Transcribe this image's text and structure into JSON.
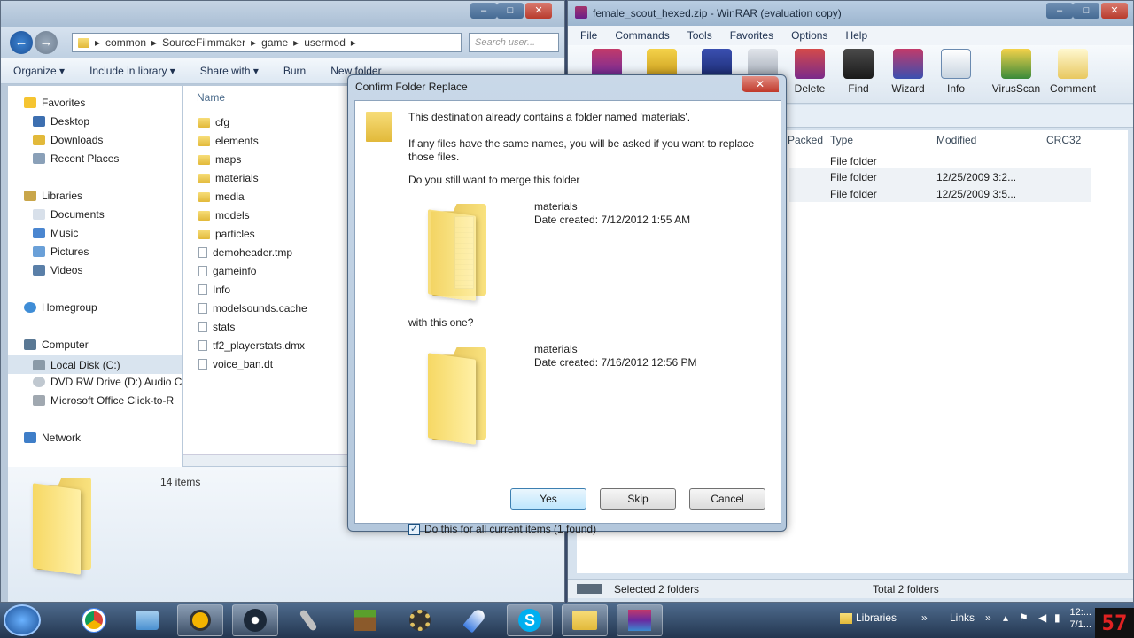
{
  "explorer": {
    "breadcrumb": [
      "common",
      "SourceFilmmaker",
      "game",
      "usermod"
    ],
    "search_placeholder": "Search user...",
    "commands": [
      "Organize ▾",
      "Include in library ▾",
      "Share with ▾",
      "Burn",
      "New folder"
    ],
    "nav": {
      "favorites": "Favorites",
      "desktop": "Desktop",
      "downloads": "Downloads",
      "recent": "Recent Places",
      "libraries": "Libraries",
      "documents": "Documents",
      "music": "Music",
      "pictures": "Pictures",
      "videos": "Videos",
      "homegroup": "Homegroup",
      "computer": "Computer",
      "local_disk": "Local Disk (C:)",
      "dvd": "DVD RW Drive (D:) Audio C",
      "office": "Microsoft Office Click-to-R",
      "network": "Network"
    },
    "column_name": "Name",
    "files": [
      {
        "name": "cfg",
        "kind": "folder"
      },
      {
        "name": "elements",
        "kind": "folder"
      },
      {
        "name": "maps",
        "kind": "folder"
      },
      {
        "name": "materials",
        "kind": "folder"
      },
      {
        "name": "media",
        "kind": "folder"
      },
      {
        "name": "models",
        "kind": "folder"
      },
      {
        "name": "particles",
        "kind": "folder"
      },
      {
        "name": "demoheader.tmp",
        "kind": "file"
      },
      {
        "name": "gameinfo",
        "kind": "file"
      },
      {
        "name": "Info",
        "kind": "file"
      },
      {
        "name": "modelsounds.cache",
        "kind": "file"
      },
      {
        "name": "stats",
        "kind": "file"
      },
      {
        "name": "tf2_playerstats.dmx",
        "kind": "file"
      },
      {
        "name": "voice_ban.dt",
        "kind": "file"
      }
    ],
    "items_count": "14 items"
  },
  "winrar": {
    "title": "female_scout_hexed.zip - WinRAR (evaluation copy)",
    "menu": [
      "File",
      "Commands",
      "Tools",
      "Favorites",
      "Options",
      "Help"
    ],
    "tools": [
      "Delete",
      "Find",
      "Wizard",
      "Info",
      "VirusScan",
      "Comment"
    ],
    "columns": {
      "packed": "Packed",
      "type": "Type",
      "modified": "Modified",
      "crc": "CRC32"
    },
    "rows": [
      {
        "type": "File folder",
        "modified": ""
      },
      {
        "type": "File folder",
        "modified": "12/25/2009 3:2..."
      },
      {
        "type": "File folder",
        "modified": "12/25/2009 3:5..."
      }
    ],
    "status_left": "Selected 2 folders",
    "status_right": "Total 2 folders"
  },
  "dialog": {
    "title": "Confirm Folder Replace",
    "line1": "This destination already contains a folder named 'materials'.",
    "line2a": "If any files have the same names, you will be asked if you want to replace",
    "line2b": "those files.",
    "question": "Do you still want to merge this folder",
    "existing_name": "materials",
    "existing_date": "Date created: 7/12/2012 1:55 AM",
    "with_text": "with this one?",
    "new_name": "materials",
    "new_date": "Date created: 7/16/2012 12:56 PM",
    "yes": "Yes",
    "skip": "Skip",
    "cancel": "Cancel",
    "checkbox_label": "Do this for all current items (1 found)",
    "checkbox_checked": true
  },
  "taskbar": {
    "tray_libraries": "Libraries",
    "tray_links": "Links",
    "clock_time": "12:...",
    "clock_date": "7/1...",
    "logo": "57"
  }
}
